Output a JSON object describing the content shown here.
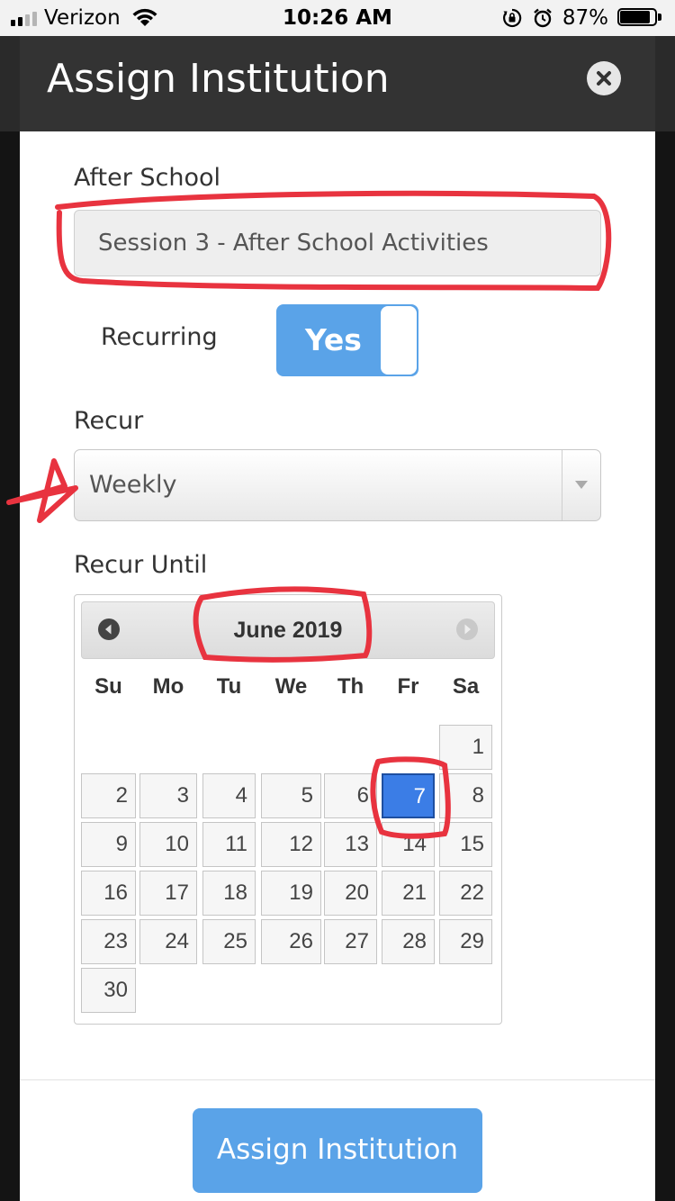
{
  "status_bar": {
    "carrier": "Verizon",
    "time": "10:26 AM",
    "battery_percent": "87%",
    "battery_level": 0.87
  },
  "modal": {
    "title": "Assign Institution",
    "close_icon": "close-icon"
  },
  "form": {
    "after_school_label": "After School",
    "after_school_value": "Session 3 - After School Activities",
    "recurring_label": "Recurring",
    "recurring_toggle_label": "Yes",
    "recur_label": "Recur",
    "recur_value": "Weekly",
    "recur_until_label": "Recur Until"
  },
  "calendar": {
    "month_label": "June 2019",
    "weekdays": [
      "Su",
      "Mo",
      "Tu",
      "We",
      "Th",
      "Fr",
      "Sa"
    ],
    "first_weekday_index": 6,
    "days_in_month": 30,
    "selected_day": 7
  },
  "footer": {
    "assign_button": "Assign Institution"
  },
  "colors": {
    "accent": "#5aa3e8",
    "selected_day": "#3b7de6",
    "annotation": "#e8333f"
  }
}
